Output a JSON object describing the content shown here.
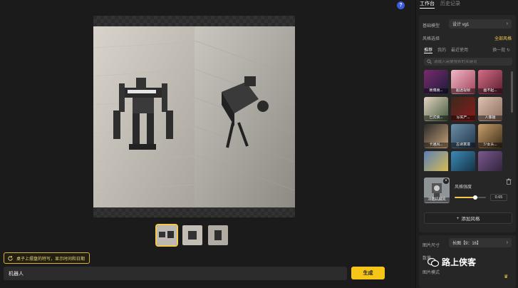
{
  "help_label": "?",
  "panel": {
    "tabs": [
      {
        "label": "工作台",
        "active": true
      },
      {
        "label": "历史记录",
        "active": false
      }
    ],
    "base_model": {
      "label": "基础模型",
      "value": "设计 vg1"
    },
    "style_select": {
      "label": "风格选择",
      "link": "全部风格"
    },
    "subtabs": [
      {
        "label": "推荐",
        "active": true
      },
      {
        "label": "我的",
        "active": false
      },
      {
        "label": "最近使用",
        "active": false
      }
    ],
    "swap_label": "换一批",
    "search_placeholder": "请输入需要搜索的关键词",
    "style_tiles": [
      {
        "label": "赛博朋..."
      },
      {
        "label": "超迷视帧"
      },
      {
        "label": "画不起..."
      },
      {
        "label": "已式俠..."
      },
      {
        "label": "写实产..."
      },
      {
        "label": "人像摄"
      },
      {
        "label": "卡通风..."
      },
      {
        "label": "古诗意境"
      },
      {
        "label": "少女头..."
      },
      {
        "label": ""
      },
      {
        "label": ""
      },
      {
        "label": ""
      }
    ],
    "selected_style": {
      "label": "冷酷机械风",
      "strength_label": "风格强度",
      "strength_value": "0.65",
      "strength_fraction": 0.65
    },
    "add_style_label": "添加风格",
    "image_size": {
      "label": "图片尺寸",
      "value": "长图【9：16】"
    },
    "count_label": "数量",
    "mode_label": "图片模式"
  },
  "main": {
    "notice": "桌子上摆盘的特写，显示时间和日期",
    "prompt_value": "机器人",
    "generate_label": "生成",
    "thumbnails": [
      {
        "name": "pair",
        "active": true
      },
      {
        "name": "front",
        "active": false
      },
      {
        "name": "side",
        "active": false
      }
    ]
  },
  "watermark": {
    "text": "路上侠客"
  },
  "colors": {
    "accent": "#f5c518",
    "panel_bg": "#1e1e1e",
    "main_bg": "#1b1b1b",
    "help": "#3b5bdb"
  }
}
